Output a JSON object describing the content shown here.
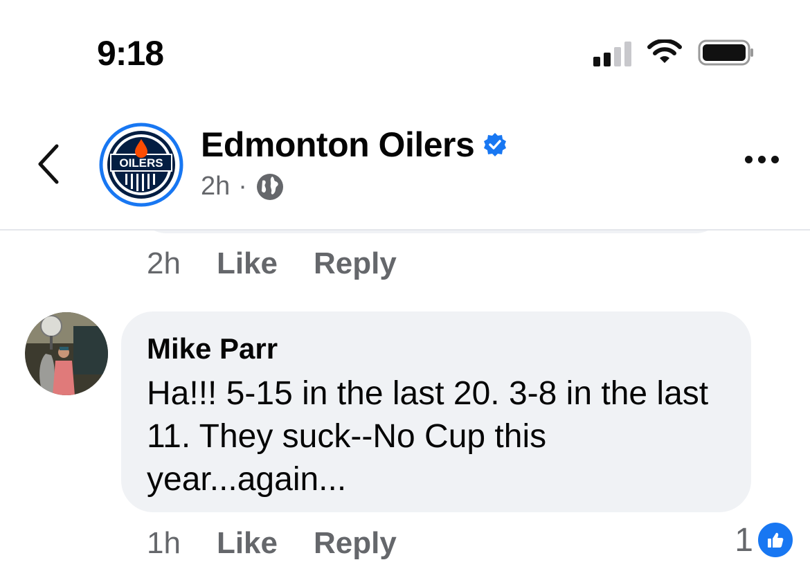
{
  "status_bar": {
    "time": "9:18",
    "icons": [
      "signal-icon",
      "wifi-icon",
      "battery-icon"
    ]
  },
  "header": {
    "page_name": "Edmonton Oilers",
    "post_time": "2h",
    "separator": "·",
    "verified": true,
    "audience_icon": "globe-icon",
    "logo_text": "OILERS"
  },
  "prev_comment": {
    "time": "2h",
    "like_label": "Like",
    "reply_label": "Reply"
  },
  "comment": {
    "author": "Mike Parr",
    "text": "Ha!!! 5-15 in the last 20.  3-8 in the last 11. They suck--No Cup this year...again...",
    "time": "1h",
    "like_label": "Like",
    "reply_label": "Reply",
    "reaction_count": "1",
    "reaction_icon": "thumbs-up-icon"
  },
  "colors": {
    "accent": "#1877f2",
    "secondary_text": "#65676b",
    "bubble": "#f0f2f5",
    "oilers_blue": "#041e42",
    "oilers_orange": "#fc4c02"
  }
}
